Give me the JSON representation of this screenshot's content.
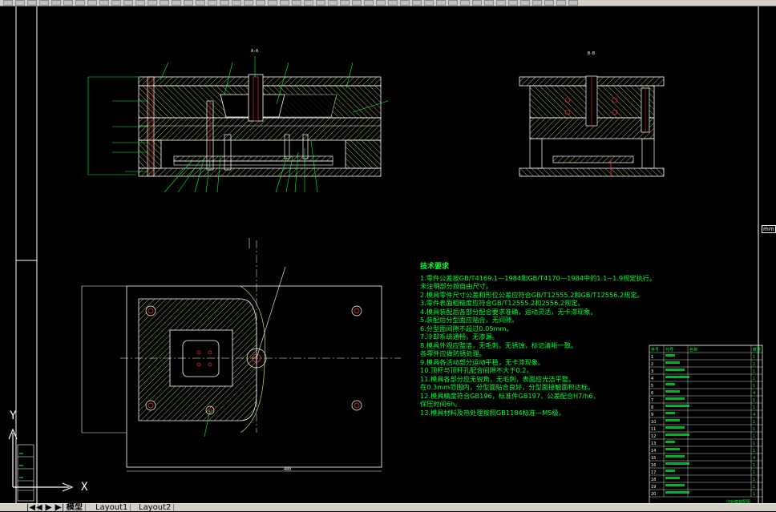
{
  "toolbar": {
    "icon_count": 48
  },
  "tabs": {
    "model": "模型",
    "layout1": "Layout1",
    "layout2": "Layout2"
  },
  "nav": {
    "first": "|◀",
    "prev": "◀",
    "next": "▶",
    "last": "▶|"
  },
  "axes": {
    "y": "Y",
    "x": "X"
  },
  "side_tab_label": "mm",
  "drawing_labels": {
    "dim_top_left": "A-A",
    "dim_top_right": "B-B",
    "dim_bottom": "480"
  },
  "notes": {
    "title": "技术要求",
    "lines": [
      "1.零件公差按GB/T4169.1—1984和GB/T4170—1984中的1.1~1.9规定执行。",
      "  未注明部分按自由尺寸。",
      "2.模具零件尺寸公差和形位公差应符合GB/T12555.2和GB/T12556.2规定。",
      "3.零件表面粗糙度应符合GB/T12555.2和2556.2规定。",
      "4.模具装配后各部分配合要求准确，运动灵活，无卡滞现象。",
      "5.装配后分型面应贴合，无间隙。",
      "6.分型面间隙不超过0.05mm。",
      "7.冷却系统通畅，无渗漏。",
      "8.模具外观应整洁，无毛刺，无锈蚀，标记清晰一致。",
      "  各零件应做防锈处理。",
      "9.模具各活动部分运动平稳，无卡滞现象。",
      "10.顶杆与顶杆孔配合间隙不大于0.2。",
      "11.模具各部分应无锐角，无毛刺，表面应光洁平整。",
      "  在0.3mm范围内，分型面贴合良好，分型面接触面积达标。",
      "12.模具精度符合GB196，标准件GB197，公差配合H7/h6，",
      "  保压时间6h。",
      "13.模具材料及热处理按照GB1184标准—M5级。"
    ]
  },
  "title_block": {
    "header": [
      "序号",
      "代号",
      "名称",
      "数量"
    ],
    "rows": [
      [
        "1",
        "",
        "",
        "1"
      ],
      [
        "2",
        "",
        "",
        "2"
      ],
      [
        "3",
        "",
        "",
        "1"
      ],
      [
        "4",
        "",
        "",
        "1"
      ],
      [
        "5",
        "",
        "",
        "1"
      ],
      [
        "6",
        "",
        "",
        "4"
      ],
      [
        "7",
        "",
        "",
        "1"
      ],
      [
        "8",
        "",
        "",
        "1"
      ],
      [
        "9",
        "",
        "",
        "4"
      ],
      [
        "10",
        "",
        "",
        "1"
      ],
      [
        "11",
        "",
        "",
        "1"
      ],
      [
        "12",
        "",
        "",
        "1"
      ],
      [
        "13",
        "",
        "",
        "1"
      ],
      [
        "14",
        "",
        "",
        "1"
      ],
      [
        "15",
        "",
        "",
        "4"
      ],
      [
        "16",
        "",
        "",
        "1"
      ],
      [
        "17",
        "",
        "",
        "1"
      ],
      [
        "18",
        "",
        "",
        "1"
      ],
      [
        "19",
        "",
        "",
        "1"
      ],
      [
        "20",
        "",
        "",
        "1"
      ]
    ],
    "footer": "注射模装配图"
  },
  "colors": {
    "background": "#000000",
    "outline": "#ffffff",
    "hatch": "#d9d97a",
    "leader": "#00ff3c",
    "dim": "#ffffff",
    "bolt": "#ff3030"
  }
}
